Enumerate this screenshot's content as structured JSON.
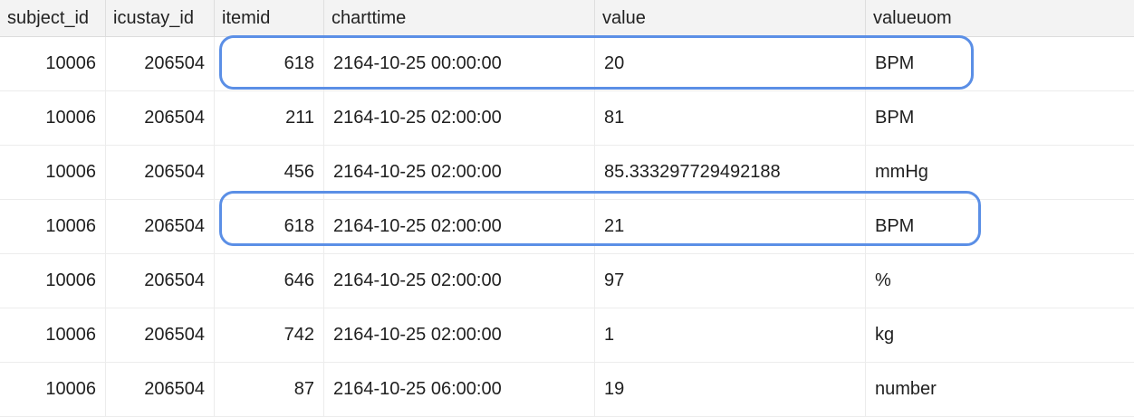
{
  "table": {
    "columns": [
      "subject_id",
      "icustay_id",
      "itemid",
      "charttime",
      "value",
      "valueuom"
    ],
    "rows": [
      [
        "10006",
        "206504",
        "618",
        "2164-10-25 00:00:00",
        "20",
        "BPM"
      ],
      [
        "10006",
        "206504",
        "211",
        "2164-10-25 02:00:00",
        "81",
        "BPM"
      ],
      [
        "10006",
        "206504",
        "456",
        "2164-10-25 02:00:00",
        "85.333297729492188",
        "mmHg"
      ],
      [
        "10006",
        "206504",
        "618",
        "2164-10-25 02:00:00",
        "21",
        "BPM"
      ],
      [
        "10006",
        "206504",
        "646",
        "2164-10-25 02:00:00",
        "97",
        "%"
      ],
      [
        "10006",
        "206504",
        "742",
        "2164-10-25 02:00:00",
        "1",
        "kg"
      ],
      [
        "10006",
        "206504",
        "87",
        "2164-10-25 06:00:00",
        "19",
        "number"
      ]
    ]
  },
  "highlights": {
    "color": "#5b8fe6",
    "highlighted_rows": [
      0,
      3
    ]
  }
}
